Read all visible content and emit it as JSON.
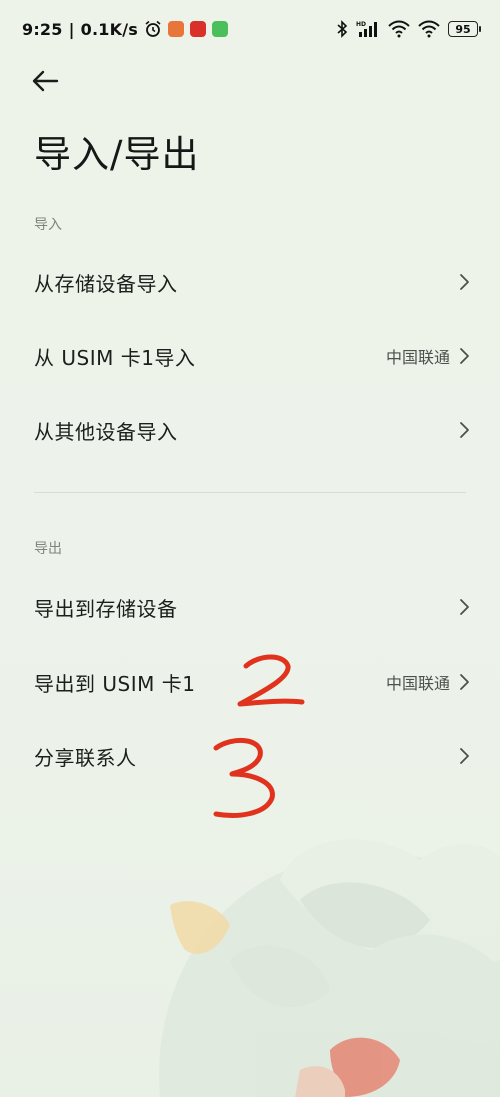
{
  "status_bar": {
    "time": "9:25",
    "separator": "|",
    "speed": "0.1K/s",
    "battery": "95",
    "network_label": "HD"
  },
  "header": {
    "title": "导入/导出"
  },
  "import_section": {
    "label": "导入",
    "items": [
      {
        "label": "从存储设备导入",
        "value": ""
      },
      {
        "label": "从 USIM 卡1导入",
        "value": "中国联通"
      },
      {
        "label": "从其他设备导入",
        "value": ""
      }
    ]
  },
  "export_section": {
    "label": "导出",
    "items": [
      {
        "label": "导出到存储设备",
        "value": ""
      },
      {
        "label": "导出到 USIM 卡1",
        "value": "中国联通"
      },
      {
        "label": "分享联系人",
        "value": ""
      }
    ]
  },
  "annotations": [
    "2",
    "3"
  ],
  "colors": {
    "background": "#edf3ea",
    "annotation": "#e0321c",
    "text": "#1c201d",
    "secondary_text": "#7d857f"
  }
}
